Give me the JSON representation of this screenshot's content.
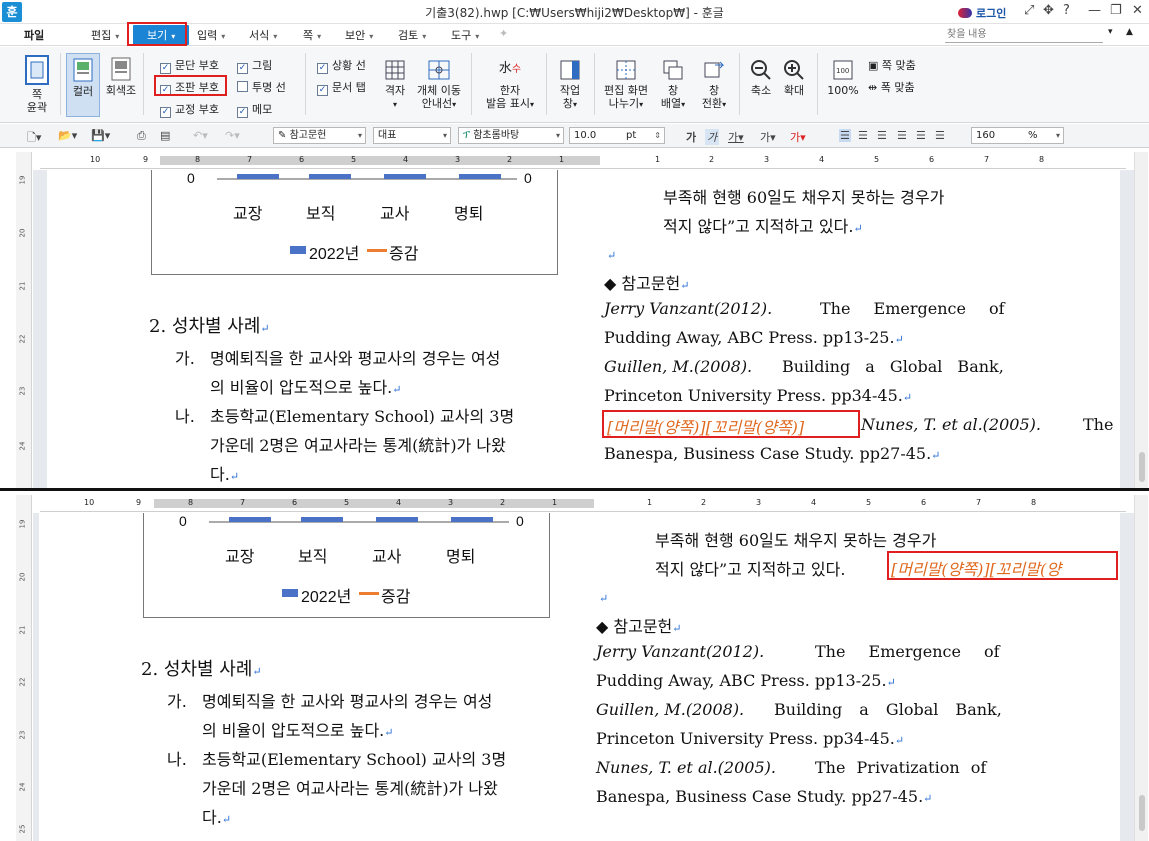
{
  "window": {
    "app_logo": "훈",
    "title": "기출3(82).hwp [C:₩Users₩hiji2₩Desktop₩] - 훈글",
    "login": "로그인",
    "controls": [
      "⤢",
      "✥",
      "?",
      "—",
      "❐",
      "✕"
    ]
  },
  "menu": {
    "file": "파일",
    "items": [
      "편집",
      "보기",
      "입력",
      "서식",
      "쪽",
      "보안",
      "검토",
      "도구"
    ],
    "active": "보기",
    "search_placeholder": "찾을 내용"
  },
  "ribbon": {
    "page_outline": [
      "쪽",
      "윤곽"
    ],
    "color": "컬러",
    "gray": "회색조",
    "checks": [
      {
        "label": "문단 부호",
        "checked": true
      },
      {
        "label": "조판 부호",
        "checked": true
      },
      {
        "label": "교정 부호",
        "checked": true
      },
      {
        "label": "그림",
        "checked": true
      },
      {
        "label": "투명 선",
        "checked": false
      },
      {
        "label": "메모",
        "checked": true
      },
      {
        "label": "상황 선",
        "checked": true
      },
      {
        "label": "문서 탭",
        "checked": true
      }
    ],
    "grid": "격자",
    "object_move": [
      "개체 이동",
      "안내선"
    ],
    "hanja": [
      "한자",
      "발음 표시"
    ],
    "task_pane": [
      "작업",
      "창"
    ],
    "split_screen": [
      "편집 화면",
      "나누기"
    ],
    "window_arrange": [
      "창",
      "배열"
    ],
    "window_switch": [
      "창",
      "전환"
    ],
    "zoom_out": "축소",
    "zoom_in": "확대",
    "zoom_100": "100%",
    "fit_page": "쪽 맞춤",
    "fit_width": "폭 맞춤"
  },
  "format": {
    "style_group": "참고문헌",
    "lang": "대표",
    "font": "함초롬바탕",
    "size": "10.0",
    "unit": "pt",
    "zoom": "160",
    "zoom_unit": "%"
  },
  "rulers": {
    "top": [
      "10",
      "9",
      "8",
      "7",
      "6",
      "5",
      "4",
      "3",
      "2",
      "1",
      "1",
      "2",
      "3",
      "4",
      "5",
      "6",
      "7",
      "8"
    ],
    "vertical_top": [
      "19",
      "20",
      "21",
      "22",
      "23",
      "24"
    ],
    "vertical_bottom": [
      "19",
      "20",
      "21",
      "22",
      "23",
      "24",
      "25"
    ]
  },
  "doc": {
    "chart": {
      "left_axis": "0",
      "right_axis": "0",
      "categories": [
        "교장",
        "보직",
        "교사",
        "명퇴"
      ],
      "legend_bar": "2022년",
      "legend_line": "증감",
      "bar_color": "#4a72c6",
      "line_color": "#ed7d31"
    },
    "heading": "2. 성차별 사례",
    "item_ga_label": "가.",
    "item_ga": [
      "명예퇴직을 한 교사와 평교사의 경우는 여성",
      "의 비율이 압도적으로 높다."
    ],
    "item_na_label": "나.",
    "item_na": [
      "초등학교(Elementary School) 교사의 3명",
      "가운데 2명은 여교사라는 통계(統計)가 나왔",
      "다."
    ],
    "quote": [
      "부족해 현행 60일도 채우지 못하는 경우가",
      "적지 않다”고 지적하고 있다."
    ],
    "refs_title": "◆ 참고문헌",
    "ref1_author": "Jerry Vanzant(2012).",
    "ref1_rest": "The Emergence of",
    "ref1_line2": "Pudding Away, ABC Press. pp13-25.",
    "ref2_author": "Guillen, M.(2008).",
    "ref2_rest": "Building a Global Bank,",
    "ref2_line2": "Princeton University Press. pp34-45.",
    "ref3_author": "Nunes, T. et al.(2005).",
    "ref3_rest_top": "The",
    "ref3_rest_bottom": "The Privatization of",
    "ref3_line2_top": "Banespa, Business Case Study. pp27-45.",
    "ref3_line2_bottom": "Banespa, Business Case Study. pp27-45.",
    "code_marker": "[머리말(양쪽)][꼬리말(양쪽)]",
    "code_marker_cut": "[머리말(양쪽)][꼬리말(양"
  }
}
